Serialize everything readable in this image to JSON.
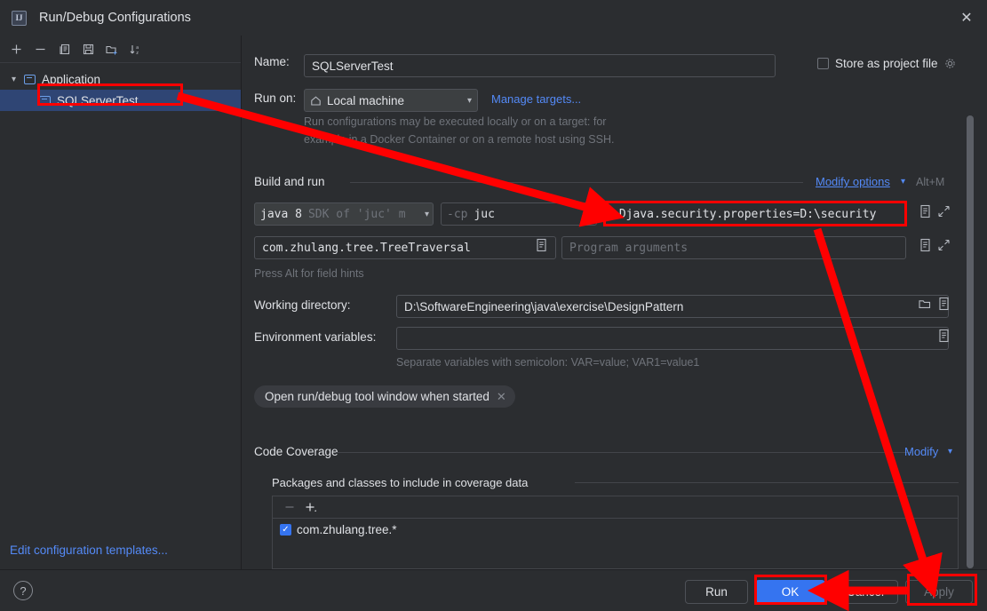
{
  "window": {
    "title": "Run/Debug Configurations",
    "app_icon": "intellij-idea-icon",
    "close_icon": "close-icon"
  },
  "toolbar": {
    "buttons": [
      {
        "name": "add-configuration-button",
        "icon": "plus-icon",
        "label": "+"
      },
      {
        "name": "remove-configuration-button",
        "icon": "minus-icon",
        "label": "−"
      },
      {
        "name": "copy-configuration-button",
        "icon": "copy-icon",
        "label": "Copy"
      },
      {
        "name": "save-configuration-button",
        "icon": "save-icon",
        "label": "Save"
      },
      {
        "name": "new-folder-button",
        "icon": "new-folder-icon",
        "label": "New Folder"
      },
      {
        "name": "sort-configurations-button",
        "icon": "sort-alphabetically-icon",
        "label": "Sort"
      }
    ]
  },
  "sidebar": {
    "tree": [
      {
        "label": "Application",
        "type": "group",
        "expanded": true,
        "icon": "application-icon"
      },
      {
        "label": "SQLServerTest",
        "type": "configuration",
        "selected": true,
        "icon": "application-icon"
      }
    ],
    "edit_templates_link": "Edit configuration templates..."
  },
  "form": {
    "name_label": "Name:",
    "name_value": "SQLServerTest",
    "store_as_project_file_label": "Store as project file",
    "store_as_project_file_checked": false,
    "store_gear_icon": "gear-icon",
    "run_on_label": "Run on:",
    "run_on_value": "Local machine",
    "run_on_icon": "home-icon",
    "manage_targets_link": "Manage targets...",
    "run_on_hint_line1": "Run configurations may be executed locally or on a target: for",
    "run_on_hint_line2": "example in a Docker Container or on a remote host using SSH."
  },
  "build_and_run": {
    "section_title": "Build and run",
    "modify_options_link": "Modify options",
    "modify_options_shortcut": "Alt+M",
    "jdk_value_main": "java 8",
    "jdk_value_sub": "SDK of 'juc' m",
    "cp_value_prefix": "-cp",
    "cp_value": "juc",
    "vm_options_value": "-Djava.security.properties=D:\\security",
    "main_class_value": "com.zhulang.tree.TreeTraversal",
    "program_arguments_placeholder": "Program arguments",
    "field_hint": "Press Alt for field hints",
    "expand_icon": "expand-icon",
    "macro_icon": "list-icon"
  },
  "directories": {
    "working_directory_label": "Working directory:",
    "working_directory_value": "D:\\SoftwareEngineering\\java\\exercise\\DesignPattern",
    "browse_icon": "folder-icon",
    "macro_icon": "list-icon",
    "environment_variables_label": "Environment variables:",
    "environment_variables_value": "",
    "env_hint": "Separate variables with semicolon: VAR=value; VAR1=value1"
  },
  "options_tag": {
    "label": "Open run/debug tool window when started",
    "close_icon": "close-icon"
  },
  "code_coverage": {
    "section_title": "Code Coverage",
    "modify_link": "Modify",
    "subsection_title": "Packages and classes to include in coverage data",
    "remove_button_icon": "minus-icon",
    "add_button_icon": "plus-icon",
    "rows": [
      {
        "label": "com.zhulang.tree.*",
        "checked": true
      }
    ]
  },
  "footer": {
    "help_icon": "question-mark-icon",
    "buttons": [
      {
        "name": "run-button",
        "label": "Run",
        "style": "default"
      },
      {
        "name": "ok-button",
        "label": "OK",
        "style": "primary"
      },
      {
        "name": "cancel-button",
        "label": "Cancel",
        "style": "default"
      },
      {
        "name": "apply-button",
        "label": "Apply",
        "style": "disabled"
      }
    ]
  },
  "annotations": {
    "highlight_color": "#ff0000",
    "boxes": [
      {
        "name": "sqlservertest-highlight"
      },
      {
        "name": "vm-options-highlight"
      },
      {
        "name": "ok-button-highlight"
      },
      {
        "name": "apply-button-highlight"
      }
    ],
    "arrows": [
      {
        "name": "arrow-config-to-vm-options"
      },
      {
        "name": "arrow-vm-options-to-apply"
      },
      {
        "name": "arrow-apply-to-ok"
      }
    ]
  },
  "colors": {
    "background": "#2b2d30",
    "selection": "#2f4574",
    "accent_blue": "#3574f0",
    "link_blue": "#548af7",
    "annotation_red": "#ff0000"
  }
}
